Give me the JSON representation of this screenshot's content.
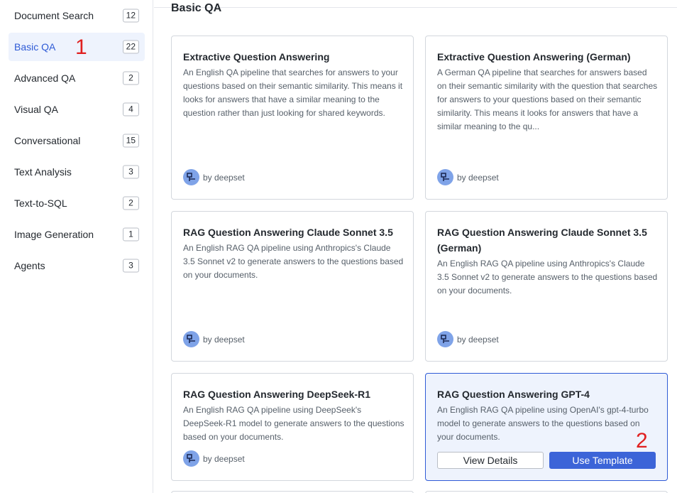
{
  "sidebar": {
    "items": [
      {
        "label": "Document Search",
        "count": "12"
      },
      {
        "label": "Basic QA",
        "count": "22"
      },
      {
        "label": "Advanced QA",
        "count": "2"
      },
      {
        "label": "Visual QA",
        "count": "4"
      },
      {
        "label": "Conversational",
        "count": "15"
      },
      {
        "label": "Text Analysis",
        "count": "3"
      },
      {
        "label": "Text-to-SQL",
        "count": "2"
      },
      {
        "label": "Image Generation",
        "count": "1"
      },
      {
        "label": "Agents",
        "count": "3"
      }
    ],
    "active_index": 1
  },
  "annotations": {
    "one": "1",
    "two": "2"
  },
  "main": {
    "section_title": "Basic QA",
    "cards": [
      {
        "title": "Extractive Question Answering",
        "description": "An English QA pipeline that searches for answers to your questions based on their semantic similarity. This means it looks for answers that have a similar meaning to the question rather than just looking for shared keywords.",
        "author": "by deepset"
      },
      {
        "title": "Extractive Question Answering (German)",
        "description": "A German QA pipeline that searches for answers based on their semantic similarity with the question that searches for answers to your questions based on their semantic similarity. This means it looks for answers that have a similar meaning to the qu...",
        "author": "by deepset"
      },
      {
        "title": "RAG Question Answering Claude Sonnet 3.5",
        "description": "An English RAG QA pipeline using Anthropics's Claude 3.5 Sonnet v2 to generate answers to the questions based on your documents.",
        "author": "by deepset"
      },
      {
        "title": "RAG Question Answering Claude Sonnet 3.5 (German)",
        "description": "An English RAG QA pipeline using Anthropics's Claude 3.5 Sonnet v2 to generate answers to the questions based on your documents.",
        "author": "by deepset"
      },
      {
        "title": "RAG Question Answering DeepSeek-R1",
        "description": "An English RAG QA pipeline using DeepSeek's DeepSeek-R1 model to generate answers to the questions based on your documents.",
        "author": "by deepset"
      },
      {
        "title": "RAG Question Answering GPT-4",
        "description": "An English RAG QA pipeline using OpenAI's gpt-4-turbo model to generate answers to the questions based on your documents.",
        "view_details": "View Details",
        "use_template": "Use Template"
      }
    ]
  },
  "colors": {
    "accent": "#3c64d8",
    "active_bg": "#eef3fd",
    "annotation": "#e02020"
  },
  "icons": {
    "author_avatar": "pipeline-icon"
  }
}
